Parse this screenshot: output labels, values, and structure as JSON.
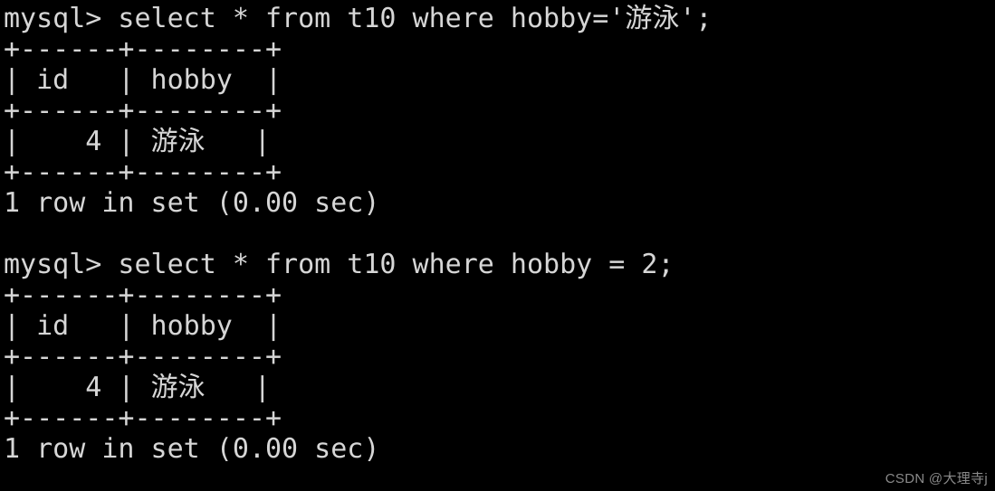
{
  "terminal": {
    "background_color": "#000000",
    "foreground_color": "#d6d6d6",
    "prompt": "mysql>",
    "lines": [
      "mysql> select * from t10 where hobby='游泳';",
      "+------+--------+",
      "| id   | hobby  |",
      "+------+--------+",
      "|    4 | 游泳   |",
      "+------+--------+",
      "1 row in set (0.00 sec)",
      "",
      "mysql> select * from t10 where hobby = 2;",
      "+------+--------+",
      "| id   | hobby  |",
      "+------+--------+",
      "|    4 | 游泳   |",
      "+------+--------+",
      "1 row in set (0.00 sec)"
    ],
    "queries": [
      {
        "command": "select * from t10 where hobby='游泳';",
        "result_table": {
          "columns": [
            "id",
            "hobby"
          ],
          "rows": [
            [
              "4",
              "游泳"
            ]
          ],
          "border": "+------+--------+"
        },
        "status": "1 row in set (0.00 sec)"
      },
      {
        "command": "select * from t10 where hobby = 2;",
        "result_table": {
          "columns": [
            "id",
            "hobby"
          ],
          "rows": [
            [
              "4",
              "游泳"
            ]
          ],
          "border": "+------+--------+"
        },
        "status": "1 row in set (0.00 sec)"
      }
    ]
  },
  "watermark": {
    "text": "CSDN @大理寺j",
    "color": "#8a8a8a"
  }
}
